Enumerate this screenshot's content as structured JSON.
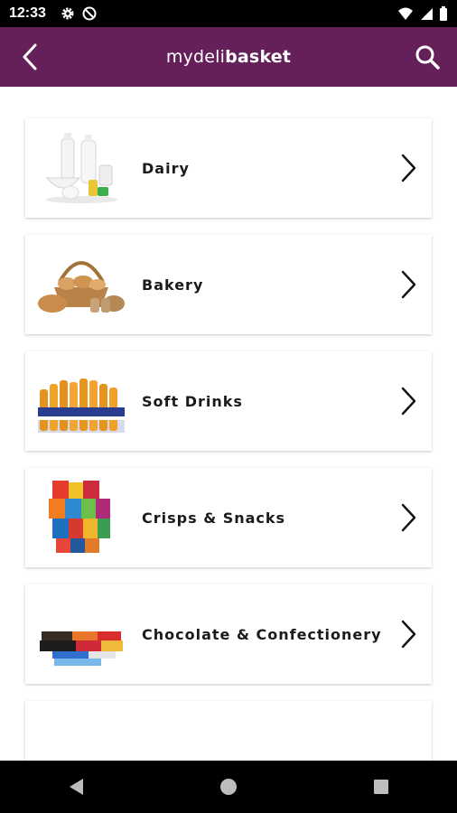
{
  "status_bar": {
    "time": "12:33",
    "icons": [
      "gear-icon",
      "no-disturb-icon",
      "wifi-icon",
      "signal-icon",
      "battery-icon"
    ]
  },
  "app_bar": {
    "title_part1": "mydeli",
    "title_part2": "basket",
    "background": "#65205a",
    "back_icon": "chevron-left-icon",
    "search_icon": "search-icon"
  },
  "categories": [
    {
      "label": "Dairy",
      "icon": "dairy-products-icon"
    },
    {
      "label": "Bakery",
      "icon": "bread-basket-icon"
    },
    {
      "label": "Soft Drinks",
      "icon": "soft-drinks-bottles-icon"
    },
    {
      "label": "Crisps & Snacks",
      "icon": "crisps-packets-icon"
    },
    {
      "label": "Chocolate & Confectionery",
      "icon": "chocolate-bars-icon"
    }
  ],
  "nav_bar": {
    "buttons": [
      "back-triangle-icon",
      "home-circle-icon",
      "recents-square-icon"
    ]
  }
}
